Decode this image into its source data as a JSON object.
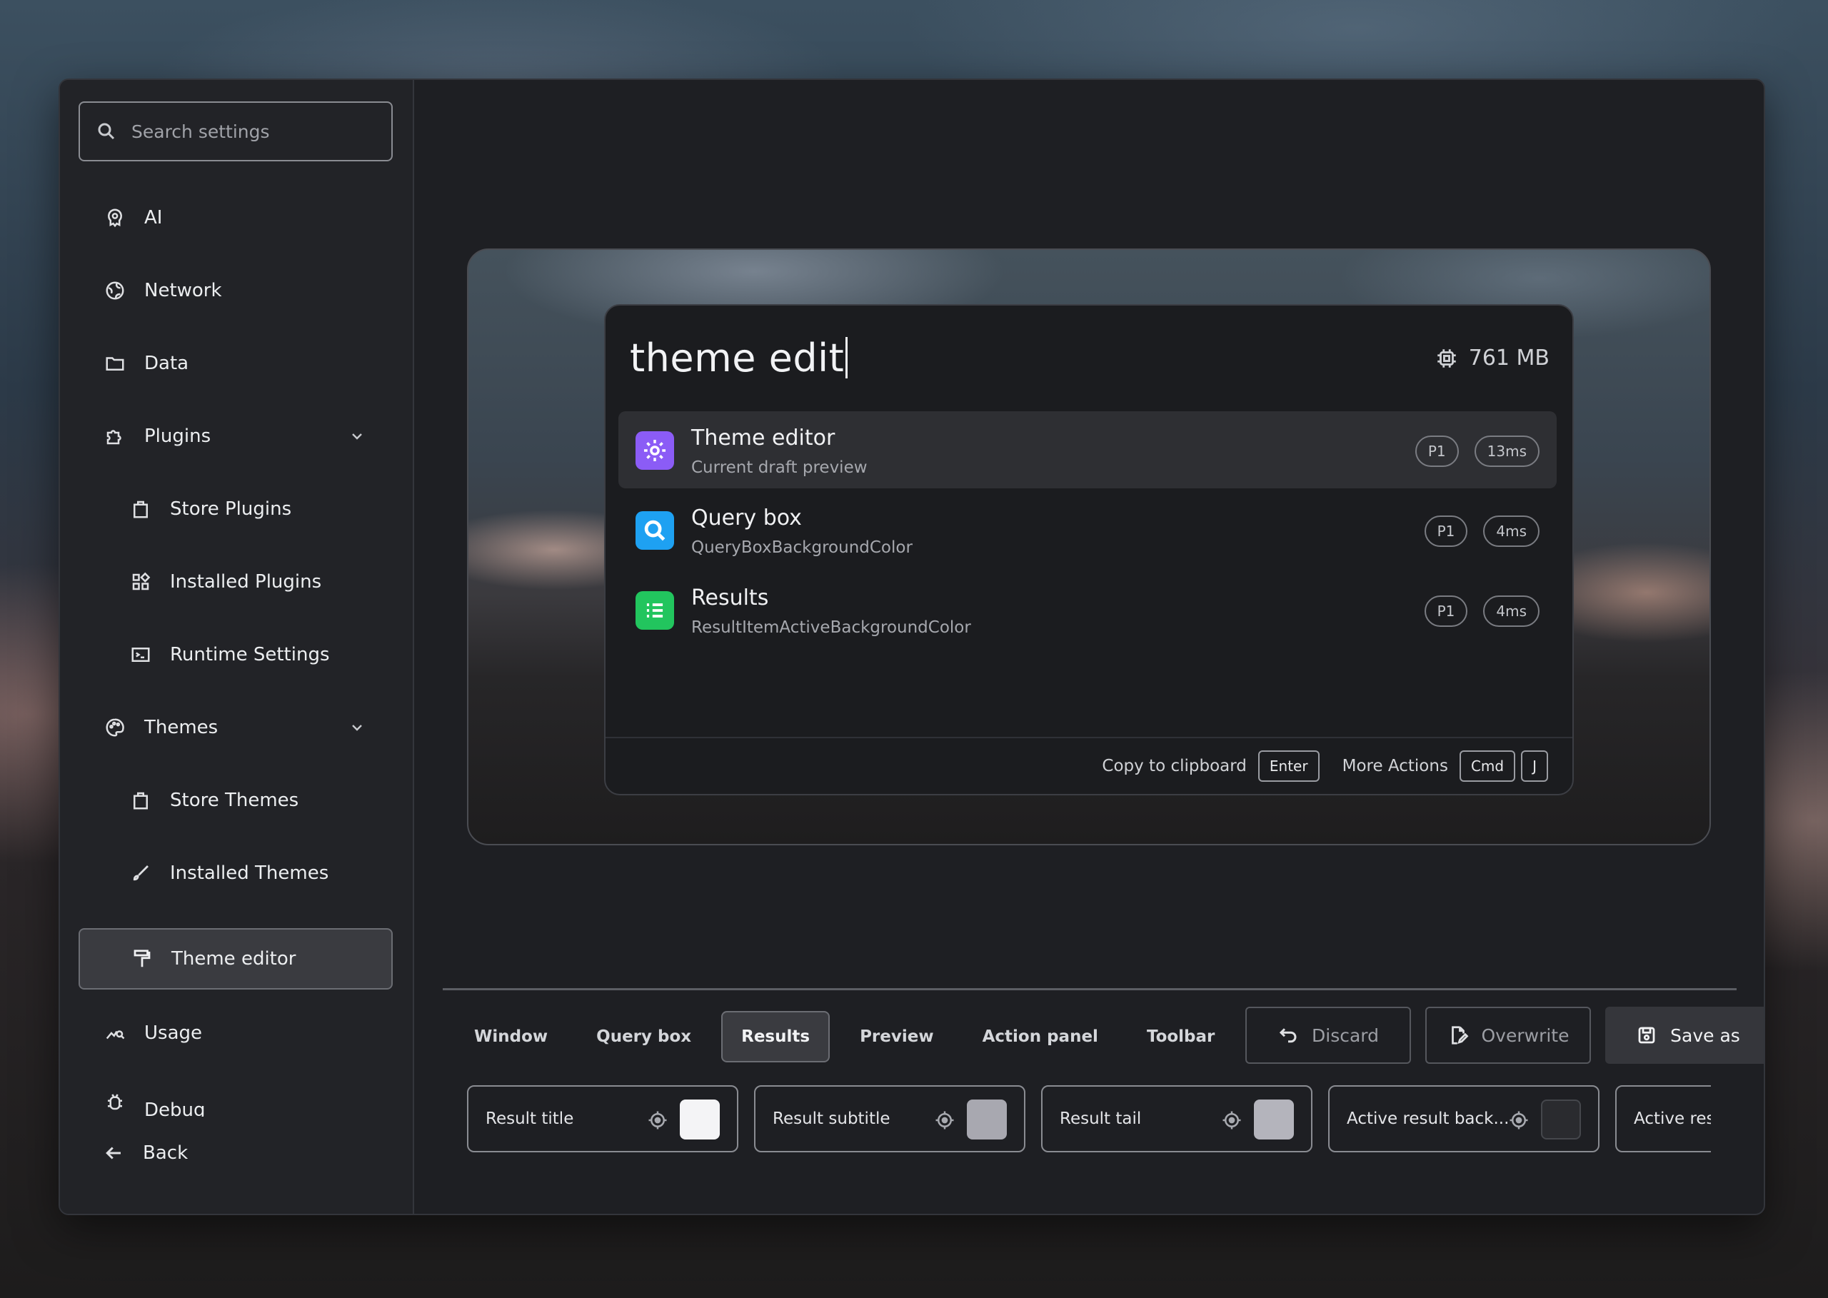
{
  "sidebar": {
    "search_placeholder": "Search settings",
    "items": [
      {
        "label": "AI",
        "icon": "brain-icon"
      },
      {
        "label": "Network",
        "icon": "globe-icon"
      },
      {
        "label": "Data",
        "icon": "folder-icon"
      },
      {
        "label": "Plugins",
        "icon": "puzzle-icon",
        "expanded": true
      },
      {
        "label": "Store Plugins",
        "icon": "shopping-bag-icon"
      },
      {
        "label": "Installed Plugins",
        "icon": "apps-icon"
      },
      {
        "label": "Runtime Settings",
        "icon": "terminal-icon"
      },
      {
        "label": "Themes",
        "icon": "palette-icon",
        "expanded": true
      },
      {
        "label": "Store Themes",
        "icon": "shopping-bag-icon"
      },
      {
        "label": "Installed Themes",
        "icon": "brush-icon"
      },
      {
        "label": "Theme editor",
        "icon": "paint-roller-icon",
        "active": true
      },
      {
        "label": "Usage",
        "icon": "analytics-icon"
      },
      {
        "label": "Debug",
        "icon": "bug-icon"
      },
      {
        "label": "Back",
        "icon": "arrow-left-icon"
      }
    ]
  },
  "preview": {
    "query": "theme edit",
    "memory": "761 MB",
    "results": [
      {
        "title": "Theme editor",
        "subtitle": "Current draft preview",
        "priority": "P1",
        "time": "13ms",
        "icon": "gear-icon",
        "color": "#8b5cf6",
        "active": true
      },
      {
        "title": "Query box",
        "subtitle": "QueryBoxBackgroundColor",
        "priority": "P1",
        "time": "4ms",
        "icon": "search-icon",
        "color": "#1ea1f2"
      },
      {
        "title": "Results",
        "subtitle": "ResultItemActiveBackgroundColor",
        "priority": "P1",
        "time": "4ms",
        "icon": "list-icon",
        "color": "#22c55e"
      }
    ],
    "footer": {
      "copy_label": "Copy to clipboard",
      "copy_key": "Enter",
      "more_label": "More Actions",
      "more_key1": "Cmd",
      "more_key2": "J"
    }
  },
  "editor": {
    "tabs": [
      "Window",
      "Query box",
      "Results",
      "Preview",
      "Action panel",
      "Toolbar"
    ],
    "active_tab": "Results",
    "buttons": {
      "discard": "Discard",
      "overwrite": "Overwrite",
      "save_as": "Save as"
    },
    "properties": [
      {
        "label": "Result title",
        "color": "#f4f4f6"
      },
      {
        "label": "Result subtitle",
        "color": "#a8a8b0"
      },
      {
        "label": "Result tail",
        "color": "#b4b4bc"
      },
      {
        "label": "Active result back...",
        "color": "#2a2b2f"
      },
      {
        "label": "Active res",
        "color": ""
      }
    ]
  }
}
